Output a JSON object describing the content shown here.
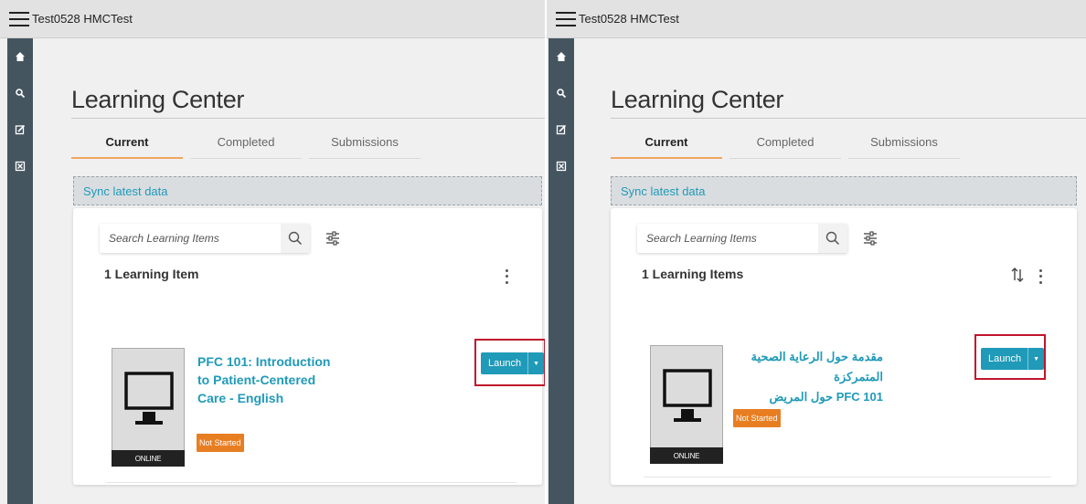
{
  "panels": [
    {
      "app_title": "Test0528 HMCTest",
      "page_title": "Learning Center",
      "tabs": [
        "Current",
        "Completed",
        "Submissions"
      ],
      "active_tab": "Current",
      "sync_label": "Sync latest data",
      "search_placeholder": "Search Learning Items",
      "count_label": "1 Learning Item",
      "item": {
        "title": "PFC 101: Introduction to Patient-Centered Care - English",
        "format_tag": "ONLINE",
        "status": "Not Started",
        "launch_label": "Launch"
      }
    },
    {
      "app_title": "Test0528 HMCTest",
      "page_title": "Learning Center",
      "tabs": [
        "Current",
        "Completed",
        "Submissions"
      ],
      "active_tab": "Current",
      "sync_label": "Sync latest data",
      "search_placeholder": "Search Learning Items",
      "count_label": "1 Learning Items",
      "item": {
        "title_line1": "مقدمة حول الرعاية الصحية المتمركزة",
        "title_line2": "PFC 101 حول المريض",
        "format_tag": "ONLINE",
        "status": "Not Started",
        "launch_label": "Launch"
      }
    }
  ],
  "colors": {
    "accent": "#1f9ab8",
    "sidebar": "#455560",
    "status_not_started": "#e87e22",
    "highlight_box": "#c0152c",
    "active_tab_underline": "#f0a560"
  },
  "icons": {
    "sidebar": [
      "home-icon",
      "search-icon",
      "edit-icon",
      "close-box-icon"
    ],
    "menu": "hamburger-icon",
    "filter": "filter-sliders-icon",
    "sort": "sort-icon",
    "more": "more-vertical-icon",
    "dropdown": "caret-down-icon"
  }
}
